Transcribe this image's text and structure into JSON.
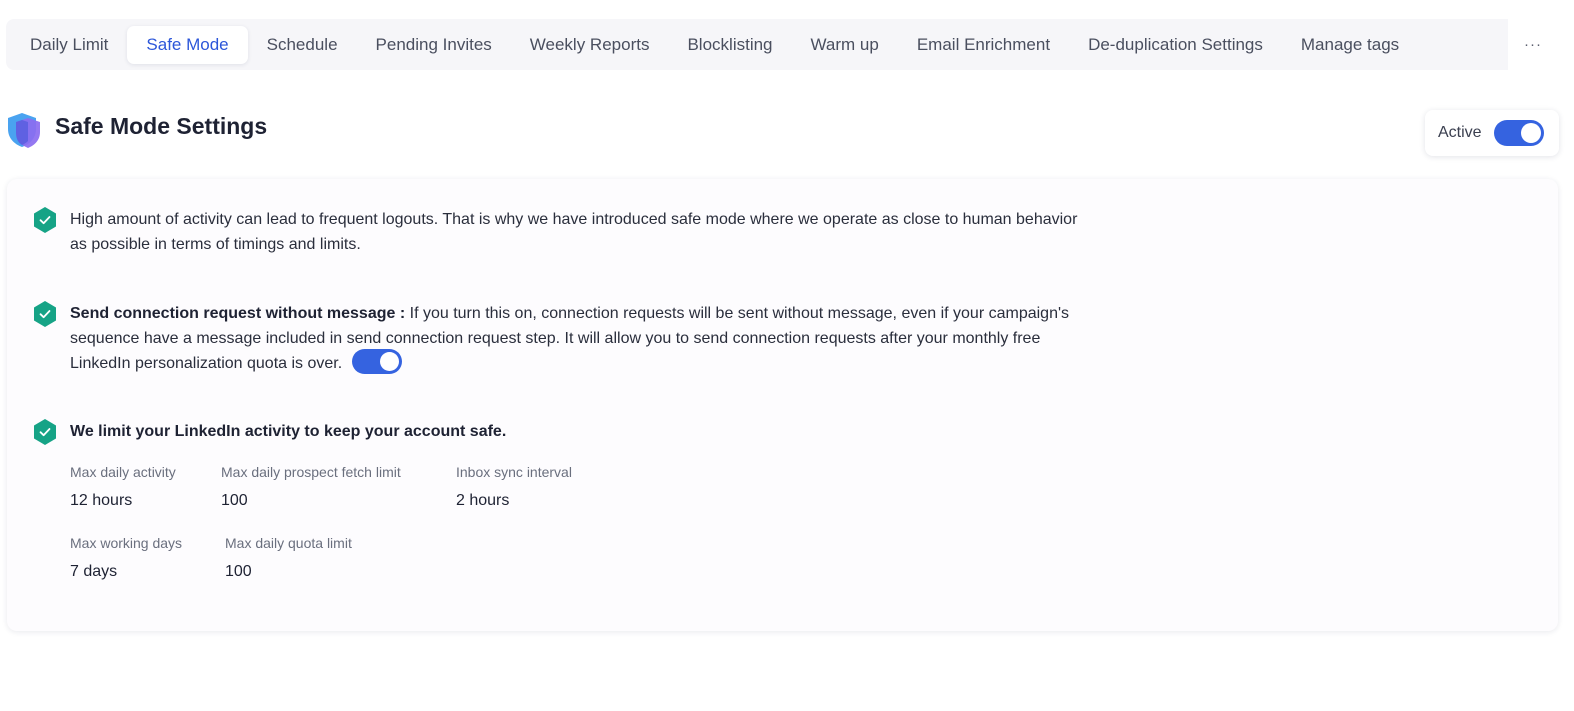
{
  "tabs": [
    {
      "label": "Daily Limit",
      "active": false
    },
    {
      "label": "Safe Mode",
      "active": true
    },
    {
      "label": "Schedule",
      "active": false
    },
    {
      "label": "Pending Invites",
      "active": false
    },
    {
      "label": "Weekly Reports",
      "active": false
    },
    {
      "label": "Blocklisting",
      "active": false
    },
    {
      "label": "Warm up",
      "active": false
    },
    {
      "label": "Email Enrichment",
      "active": false
    },
    {
      "label": "De-duplication Settings",
      "active": false
    },
    {
      "label": "Manage tags",
      "active": false
    }
  ],
  "more_label": "···",
  "header": {
    "title": "Safe Mode Settings",
    "status_label": "Active",
    "status_on": true
  },
  "items": {
    "intro": {
      "text": "High amount of activity can lead to frequent logouts. That is why we have introduced safe mode where we operate as close to human behavior as possible in terms of timings and limits."
    },
    "connection": {
      "bold": "Send connection request without message :",
      "text": " If you turn this on, connection requests will be sent without message, even if your campaign's sequence have a message included in send connection request step. It will allow you to send connection requests after your monthly free LinkedIn personalization quota is over.",
      "toggle_on": true
    },
    "limits": {
      "title": "We limit your LinkedIn activity to keep your account safe.",
      "stats": {
        "max_daily_activity": {
          "label": "Max daily activity",
          "value": "12 hours"
        },
        "max_prospect_fetch": {
          "label": "Max daily prospect fetch limit",
          "value": "100"
        },
        "inbox_sync": {
          "label": "Inbox sync interval",
          "value": "2 hours"
        },
        "max_working_days": {
          "label": "Max working days",
          "value": "7 days"
        },
        "max_quota": {
          "label": "Max daily quota limit",
          "value": "100"
        }
      }
    }
  },
  "colors": {
    "accent": "#3563e0",
    "active_tab_text": "#2c56d9",
    "check_green": "#16a386",
    "shield_blue": "#4aa3f0",
    "shield_purple": "#8b6cf0"
  }
}
